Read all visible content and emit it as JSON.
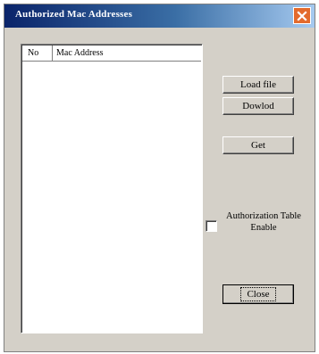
{
  "window": {
    "title": "Authorized Mac Addresses",
    "close_icon": "close-icon"
  },
  "list": {
    "columns": [
      "No",
      "Mac Address"
    ],
    "rows": []
  },
  "buttons": {
    "load_file": "Load file",
    "download": "Dowlod",
    "get": "Get",
    "close": "Close"
  },
  "authorization": {
    "label_line1": "Authorization Table",
    "label_line2": "Enable",
    "checked": false
  },
  "colors": {
    "dialog_face": "#d4d0c8",
    "title_start": "#0a246a",
    "title_end": "#a6caf0",
    "close_button": "#e36a2c"
  }
}
